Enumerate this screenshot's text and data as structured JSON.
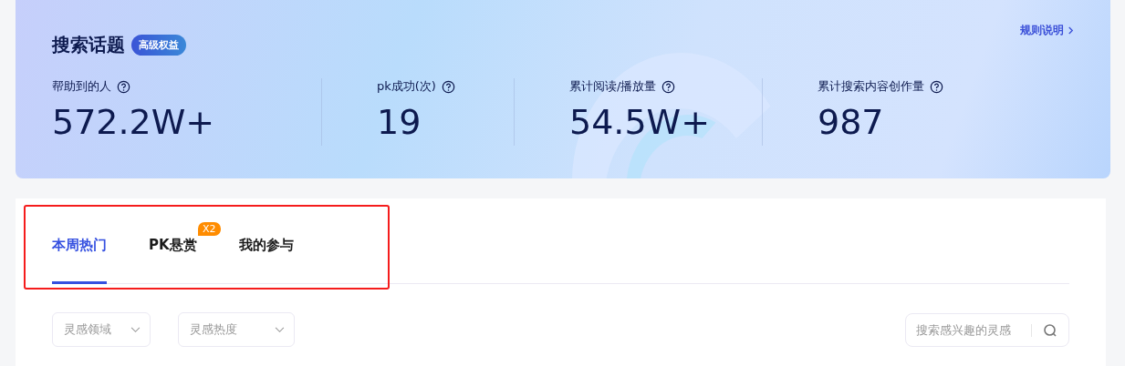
{
  "header": {
    "title": "搜索话题",
    "badge": "高级权益",
    "rules_link": "规则说明"
  },
  "stats": [
    {
      "label": "帮助到的人",
      "value": "572.2W+"
    },
    {
      "label": "pk成功(次)",
      "value": "19"
    },
    {
      "label": "累计阅读/播放量",
      "value": "54.5W+"
    },
    {
      "label": "累计搜索内容创作量",
      "value": "987"
    }
  ],
  "tabs": [
    {
      "label": "本周热门",
      "selected": true
    },
    {
      "label": "PK悬赏",
      "selected": false,
      "badge": "X2"
    },
    {
      "label": "我的参与",
      "selected": false
    }
  ],
  "filters": [
    {
      "placeholder": "灵感领域"
    },
    {
      "placeholder": "灵感热度"
    }
  ],
  "search": {
    "placeholder": "搜索感兴趣的灵感"
  }
}
